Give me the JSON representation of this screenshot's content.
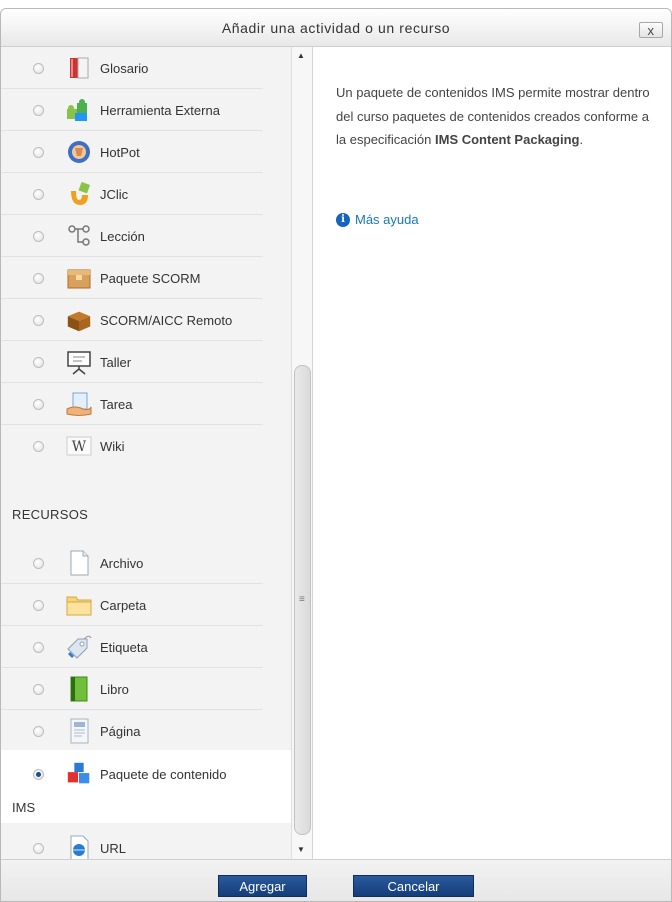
{
  "dialog": {
    "title": "Añadir una actividad o un recurso",
    "close_label": "x"
  },
  "activities": [
    {
      "label": "Glosario",
      "icon": "glossary-icon"
    },
    {
      "label": "Herramienta Externa",
      "icon": "puzzle-icon"
    },
    {
      "label": "HotPot",
      "icon": "hotpot-icon"
    },
    {
      "label": "JClic",
      "icon": "jclic-icon"
    },
    {
      "label": "Lección",
      "icon": "lesson-icon"
    },
    {
      "label": "Paquete SCORM",
      "icon": "scorm-package-icon"
    },
    {
      "label": "SCORM/AICC Remoto",
      "icon": "remote-box-icon"
    },
    {
      "label": "Taller",
      "icon": "workshop-icon"
    },
    {
      "label": "Tarea",
      "icon": "assignment-icon"
    },
    {
      "label": "Wiki",
      "icon": "wiki-icon"
    }
  ],
  "resources_heading": "RECURSOS",
  "resources": [
    {
      "label": "Archivo",
      "icon": "file-icon"
    },
    {
      "label": "Carpeta",
      "icon": "folder-icon"
    },
    {
      "label": "Etiqueta",
      "icon": "label-tag-icon"
    },
    {
      "label": "Libro",
      "icon": "book-icon"
    },
    {
      "label": "Página",
      "icon": "page-icon"
    }
  ],
  "selected_resource": {
    "label_line1": "Paquete de contenido",
    "label_line2": "IMS",
    "icon": "ims-package-icon"
  },
  "last_resource": {
    "label": "URL",
    "icon": "url-icon"
  },
  "description": {
    "text": "Un paquete de contenidos IMS permite mostrar dentro del curso paquetes de contenidos creados conforme a la especificación ",
    "bold": "IMS Content Packaging",
    "end": "."
  },
  "help_link": "Más ayuda",
  "buttons": {
    "add": "Agregar",
    "cancel": "Cancelar"
  },
  "colors": {
    "button": "#1f4c8c",
    "link": "#1a78b4",
    "info_icon": "#1565c0"
  }
}
